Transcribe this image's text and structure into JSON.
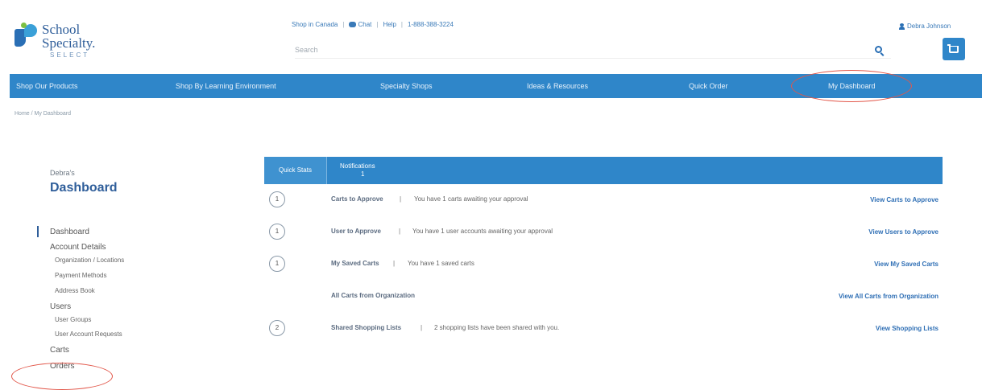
{
  "brand": {
    "line1": "School",
    "line2": "Specialty.",
    "line3": "SELECT"
  },
  "topbar": {
    "shop_canada": "Shop in Canada",
    "chat": "Chat",
    "help": "Help",
    "phone": "1-888-388-3224",
    "separator": "|"
  },
  "search": {
    "placeholder": "Search"
  },
  "user": {
    "name": "Debra Johnson"
  },
  "nav": {
    "items": [
      "Shop Our Products",
      "Shop By Learning Environment",
      "Specialty Shops",
      "Ideas & Resources",
      "Quick Order",
      "My Dashboard"
    ]
  },
  "breadcrumb": "Home  /  My Dashboard",
  "sidebar": {
    "owner": "Debra's",
    "title": "Dashboard",
    "items": [
      {
        "label": "Dashboard",
        "level": 1
      },
      {
        "label": "Account Details",
        "level": 1
      },
      {
        "label": "Organization / Locations",
        "level": 2
      },
      {
        "label": "Payment Methods",
        "level": 2
      },
      {
        "label": "Address Book",
        "level": 2
      },
      {
        "label": "Users",
        "level": 1
      },
      {
        "label": "User Groups",
        "level": 2
      },
      {
        "label": "User Account Requests",
        "level": 2
      },
      {
        "label": "Carts",
        "level": 1
      },
      {
        "label": "Orders",
        "level": 1
      }
    ]
  },
  "tabs": {
    "quick_stats": "Quick Stats",
    "notifications": "Notifications",
    "notifications_count": "1"
  },
  "rows": [
    {
      "count": "1",
      "label": "Carts to Approve",
      "desc": "You have 1 carts awaiting your approval",
      "link": "View Carts to Approve"
    },
    {
      "count": "1",
      "label": "User to Approve",
      "desc": "You have 1 user accounts awaiting your approval",
      "link": "View Users to Approve"
    },
    {
      "count": "1",
      "label": "My Saved Carts",
      "desc": "You have 1 saved carts",
      "link": "View My Saved Carts"
    },
    {
      "count": "",
      "label": "All Carts from Organization",
      "desc": "",
      "link": "View All Carts from Organization"
    },
    {
      "count": "2",
      "label": "Shared Shopping Lists",
      "desc": "2 shopping lists have been shared with you.",
      "link": "View Shopping Lists"
    }
  ],
  "colors": {
    "primary_blue": "#2f86c9",
    "dark_blue": "#2f5e9a",
    "annotation_red": "#e2574a"
  }
}
